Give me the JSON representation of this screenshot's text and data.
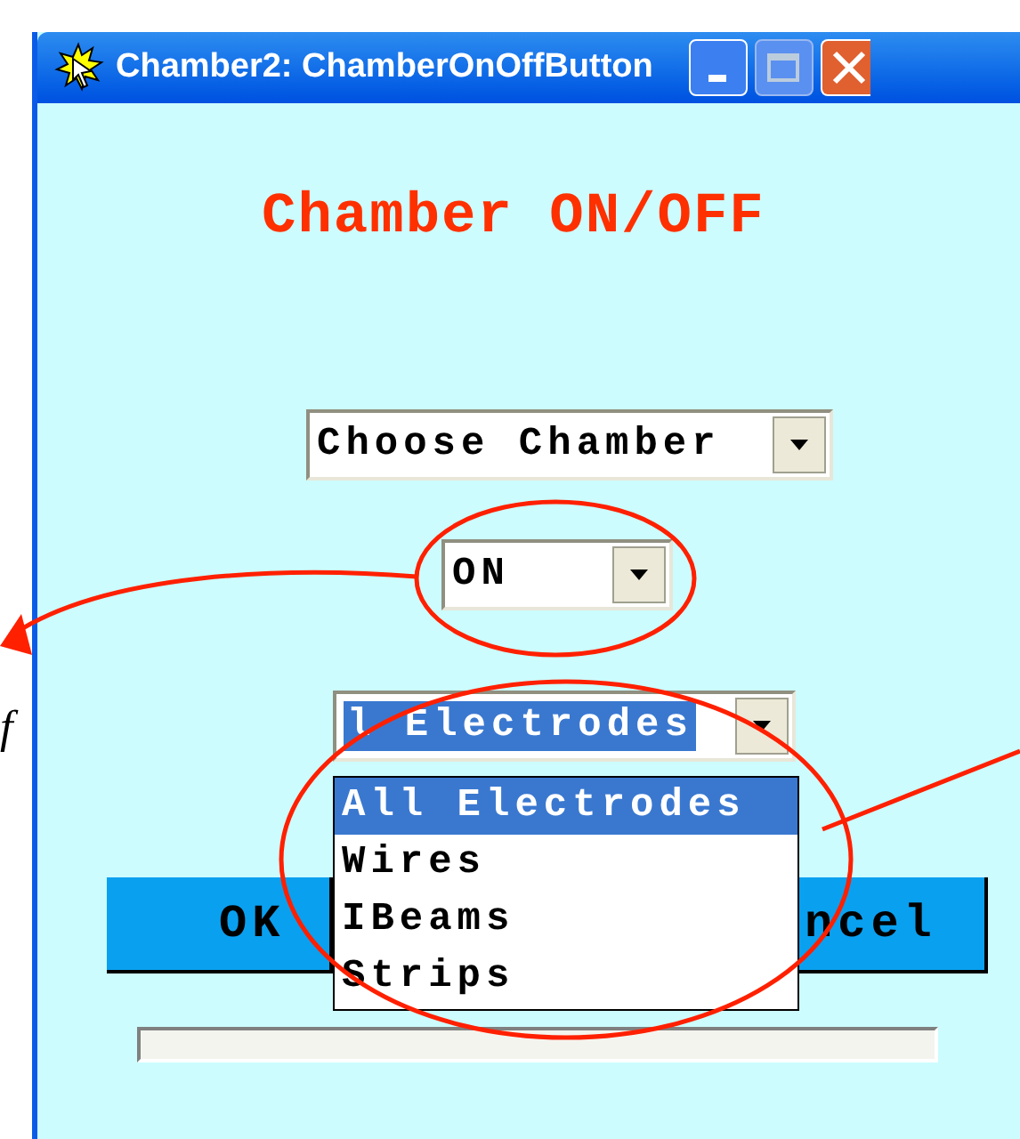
{
  "window": {
    "title": "Chamber2: ChamberOnOffButton"
  },
  "heading": "Chamber ON/OFF",
  "chamber_select": {
    "value": "Choose Chamber"
  },
  "state_select": {
    "value": "ON"
  },
  "electrode_select": {
    "value": "l Electrodes",
    "expanded": true,
    "options": [
      {
        "label": "All Electrodes",
        "selected": true
      },
      {
        "label": "Wires",
        "selected": false
      },
      {
        "label": "IBeams",
        "selected": false
      },
      {
        "label": "Strips",
        "selected": false
      }
    ]
  },
  "buttons": [
    {
      "label": "OK"
    },
    {
      "label": "ncel"
    }
  ],
  "progress": {
    "kind": "empty"
  },
  "margin_text": "f"
}
